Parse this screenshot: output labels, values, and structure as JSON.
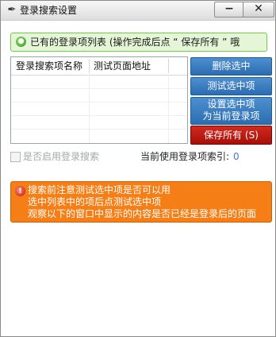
{
  "window": {
    "title": "登录搜索设置",
    "title_icon": "pen-icon",
    "minimize_glyph": "−",
    "close_glyph": "✕"
  },
  "banner": {
    "icon": "info-icon",
    "text": "已有的登录项列表 (操作完成后点 “ 保存所有 ” 哦"
  },
  "list": {
    "columns": [
      "登录搜索项名称",
      "测试页面地址"
    ],
    "rows": []
  },
  "buttons": {
    "delete": "删除选中",
    "test": "测试选中项",
    "set_current_line1": "设置选中项",
    "set_current_line2": "为当前登录项",
    "save_all": "保存所有 (S)"
  },
  "options": {
    "enable_login_search": "是否启用登录搜索",
    "enable_login_search_checked": false,
    "current_index_label": "当前使用登录项索引:",
    "current_index_value": "0"
  },
  "warning": {
    "icon": "alert-icon",
    "lines": [
      "搜索前注意测试选中项是否可以用",
      "选中列表中的项后点测试选中项",
      "观察以下的窗口中显示的内容是否已经是登录后的页面"
    ]
  },
  "colors": {
    "blue_button": "#2c6db2",
    "red_button": "#a80f08",
    "banner_bg": "#e4f6d6",
    "warning_bg": "#f57e16"
  }
}
